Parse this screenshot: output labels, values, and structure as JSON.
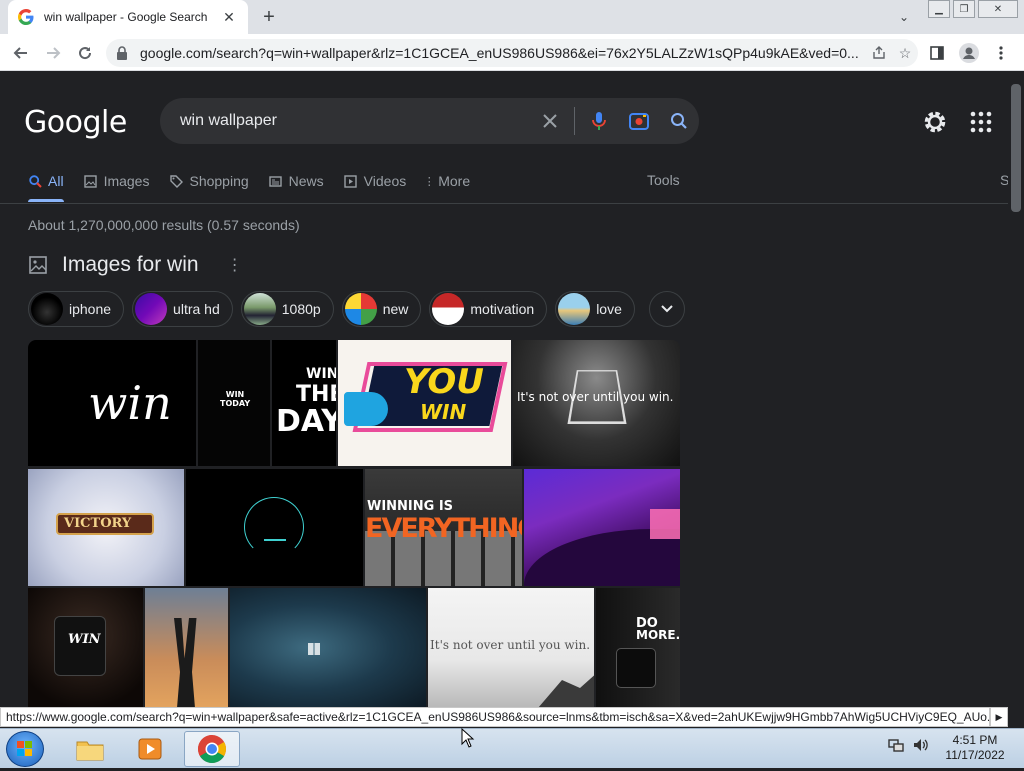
{
  "browser": {
    "tab_title": "win wallpaper - Google Search",
    "url": "google.com/search?q=win+wallpaper&rlz=1C1GCEA_enUS986US986&ei=76x2Y5LALZzW1sQPp4u9kAE&ved=0..."
  },
  "google": {
    "logo_text": "Google",
    "query": "win wallpaper",
    "tabs": [
      {
        "label": "All",
        "icon": "search-icon"
      },
      {
        "label": "Images",
        "icon": "image-icon"
      },
      {
        "label": "Shopping",
        "icon": "tag-icon"
      },
      {
        "label": "News",
        "icon": "news-icon"
      },
      {
        "label": "Videos",
        "icon": "play-icon"
      },
      {
        "label": "More",
        "icon": "more-vert-icon"
      }
    ],
    "tools_label": "Tools",
    "right_cut_letter": "S",
    "stats": "About 1,270,000,000 results (0.57 seconds)",
    "images_heading": "Images for win",
    "chips": [
      {
        "label": "iphone"
      },
      {
        "label": "ultra hd"
      },
      {
        "label": "1080p"
      },
      {
        "label": "new"
      },
      {
        "label": "motivation"
      },
      {
        "label": "love"
      }
    ],
    "tiles": {
      "t1": "win",
      "t2": "WIN TODAY",
      "t3a": "WIN",
      "t3b": "THE",
      "t3c": "DAY",
      "t4a": "YOU",
      "t4b": "WIN",
      "t5": "It's not over until you win.",
      "t6": "VICTORY",
      "t8a": "WINNING IS",
      "t8b": "EVERYTHING",
      "t10": "WIN",
      "t13": "It's not over until you win.",
      "t14a": "DO",
      "t14b": "MORE."
    }
  },
  "status_url": "https://www.google.com/search?q=win+wallpaper&safe=active&rlz=1C1GCEA_enUS986US986&source=lnms&tbm=isch&sa=X&ved=2ahUKEwjjw9HGmbb7AhWig5UCHViyC9EQ_AUo...",
  "taskbar": {
    "time": "4:51 PM",
    "date": "11/17/2022"
  },
  "colors": {
    "page_bg": "#202124",
    "search_bg": "#303134",
    "active_tab": "#8ab4f8"
  }
}
